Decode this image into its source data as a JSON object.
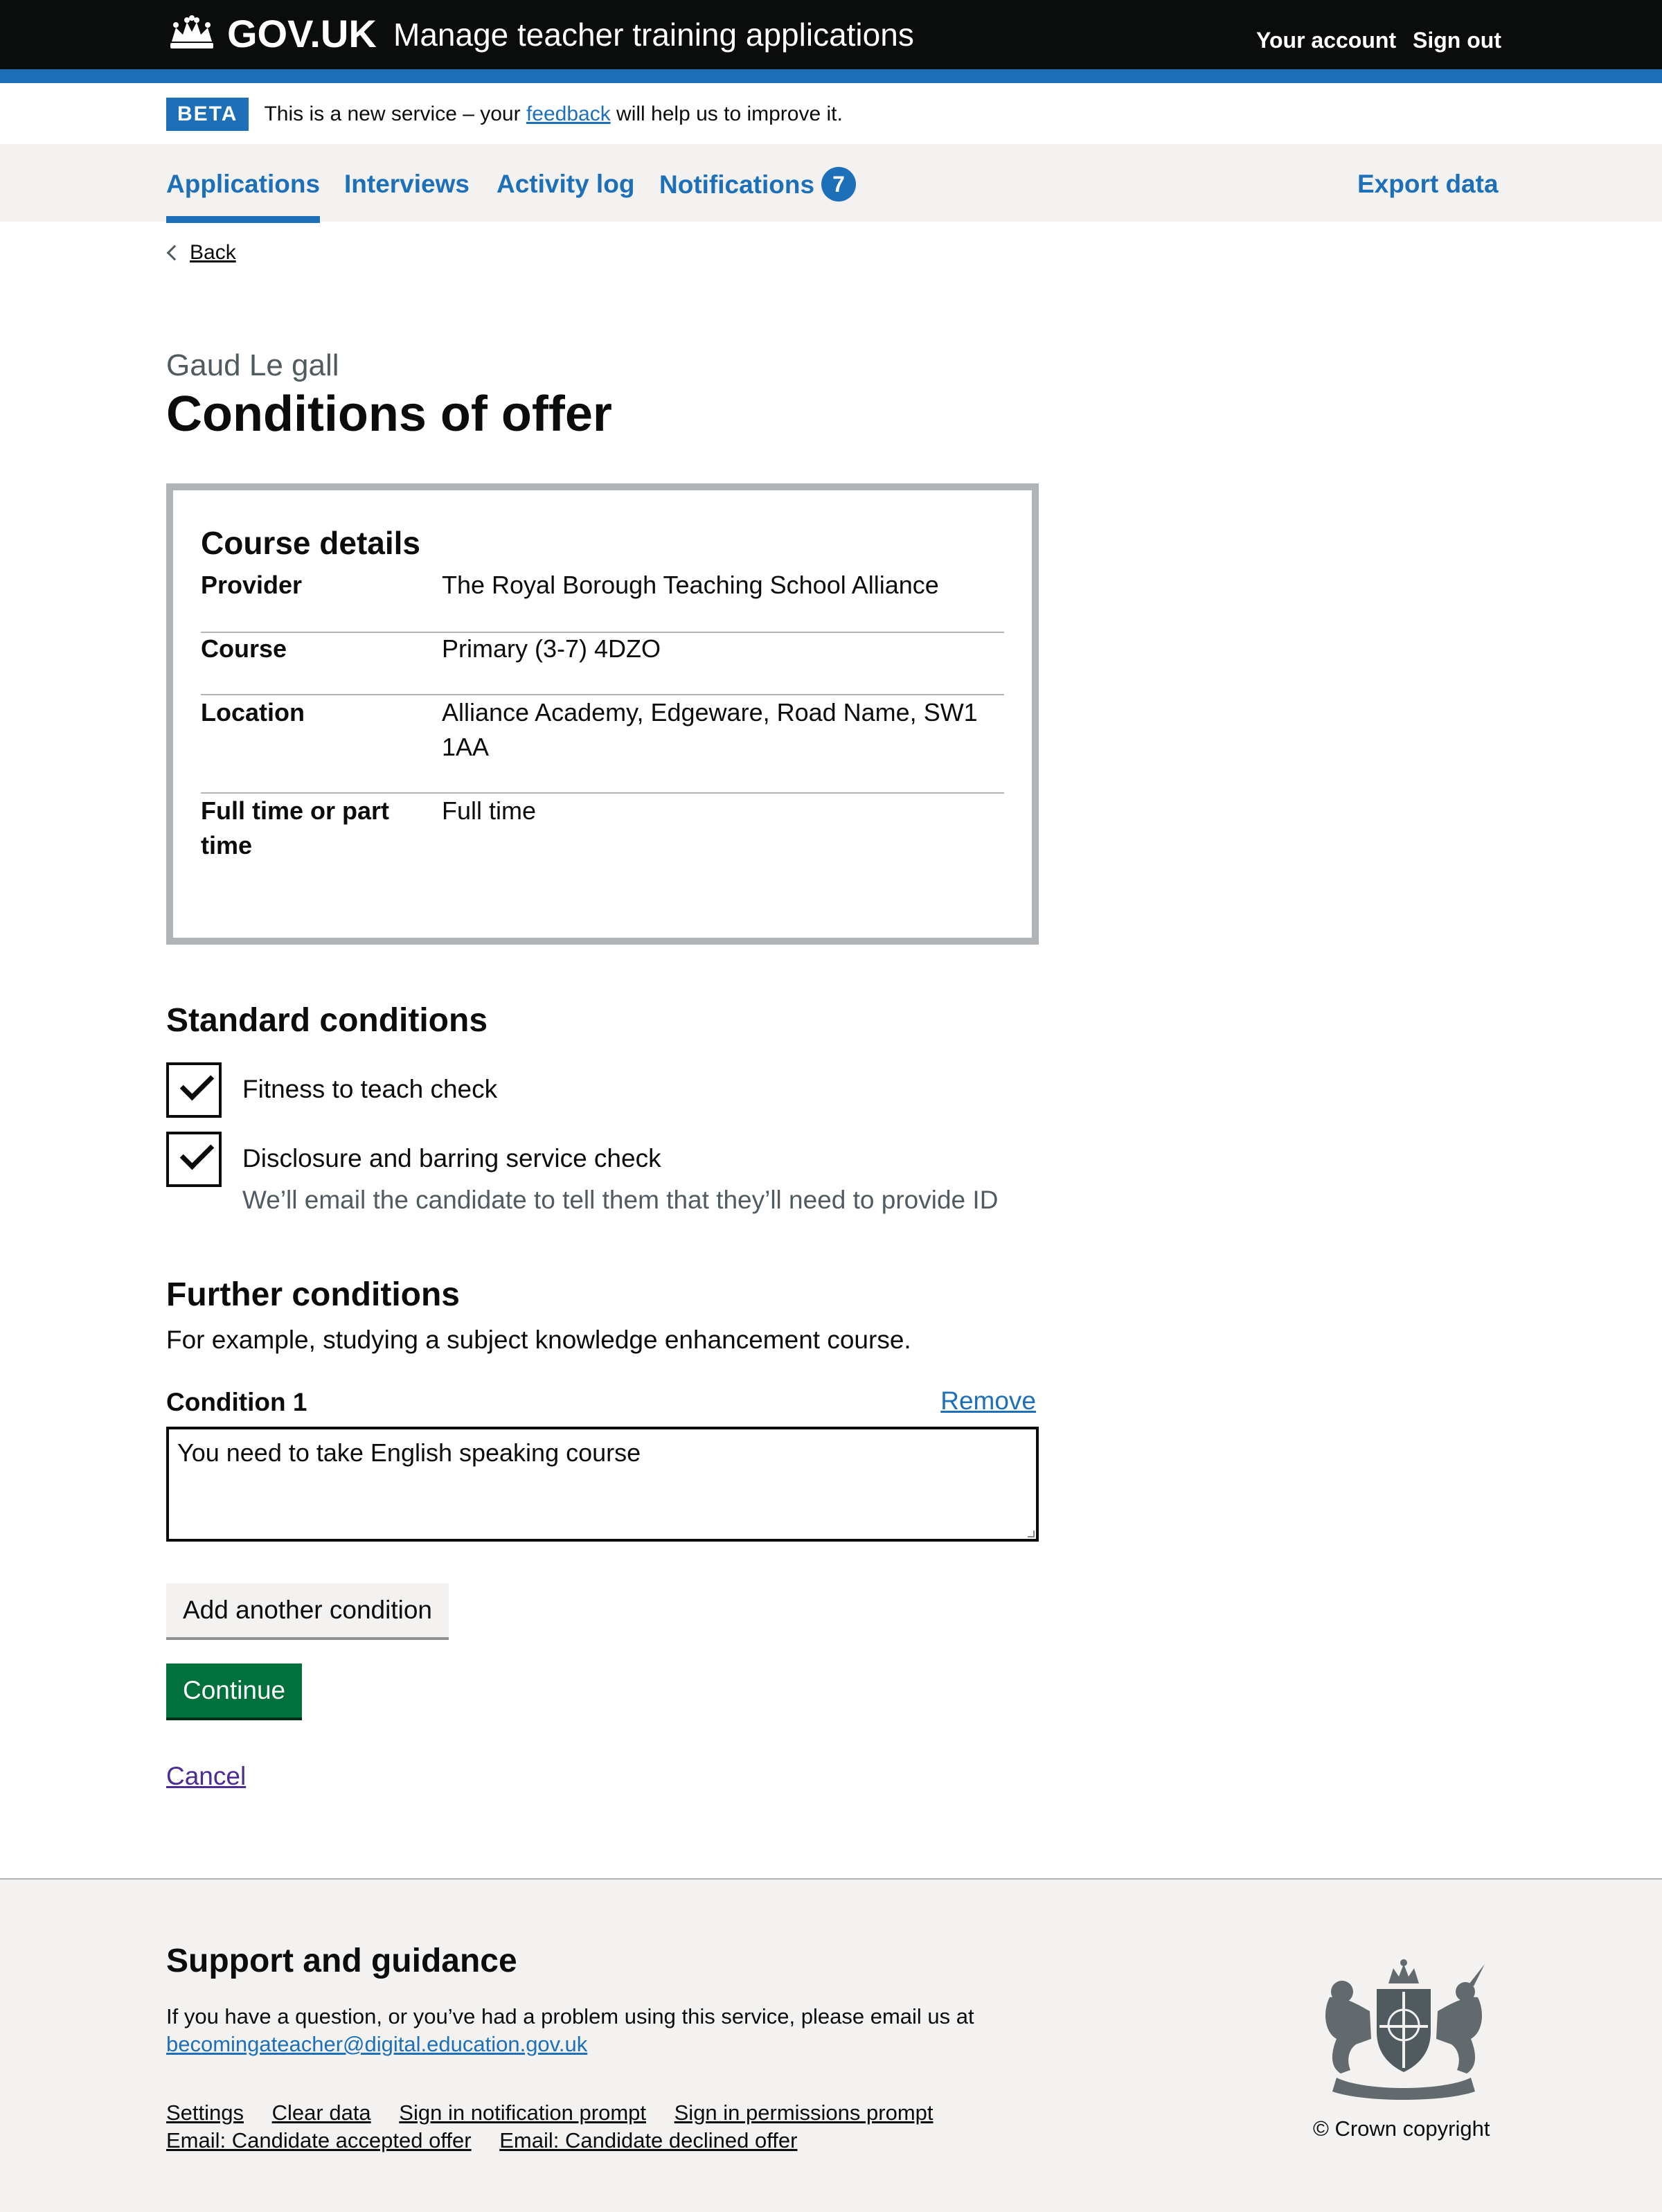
{
  "header": {
    "logo_text": "GOV.UK",
    "service_name": "Manage teacher training applications",
    "your_account": "Your account",
    "sign_out": "Sign out"
  },
  "beta": {
    "tag": "BETA",
    "text_before": "This is a new service – your",
    "feedback_link": "feedback",
    "text_after": "will help us to improve it."
  },
  "nav": {
    "items": [
      {
        "label": "Applications",
        "current": true
      },
      {
        "label": "Interviews"
      },
      {
        "label": "Activity log"
      },
      {
        "label": "Notifications",
        "badge": "7"
      }
    ],
    "export": "Export data"
  },
  "back_link": "Back",
  "caption": "Gaud Le gall",
  "title": "Conditions of offer",
  "course_details": {
    "title": "Course details",
    "rows": [
      {
        "key": "Provider",
        "value": "The Royal Borough Teaching School Alliance"
      },
      {
        "key": "Course",
        "value": "Primary (3-7) 4DZO"
      },
      {
        "key": "Location",
        "value": "Alliance Academy, Edgeware, Road Name, SW1 1AA"
      },
      {
        "key": "Full time or part time",
        "value": "Full time"
      }
    ]
  },
  "standard_conditions": {
    "title": "Standard conditions",
    "items": [
      {
        "label": "Fitness to teach check",
        "checked": true
      },
      {
        "label": "Disclosure and barring service check",
        "hint": "We’ll email the candidate to tell them that they’ll need to provide ID",
        "checked": true
      }
    ]
  },
  "further_conditions": {
    "title": "Further conditions",
    "hint": "For example, studying a subject knowledge enhancement course.",
    "condition_label": "Condition 1",
    "remove_link": "Remove",
    "condition_value": "You need to take English speaking course"
  },
  "buttons": {
    "add_another": "Add another condition",
    "continue": "Continue",
    "cancel": "Cancel"
  },
  "footer": {
    "title": "Support and guidance",
    "text": "If you have a question, or you’ve had a problem using this service, please email us at",
    "email": "becomingateacher@digital.education.gov.uk",
    "links": [
      "Settings",
      "Clear data",
      "Sign in notification prompt",
      "Sign in permissions prompt",
      "Email: Candidate accepted offer",
      "Email: Candidate declined offer"
    ],
    "copyright": "© Crown copyright"
  },
  "colors": {
    "header_bg": "#0b0c0c",
    "brand_blue": "#1d70b8",
    "button_green": "#00703c",
    "visited_link": "#4c2c92",
    "footer_bg": "#f3f2f1"
  }
}
